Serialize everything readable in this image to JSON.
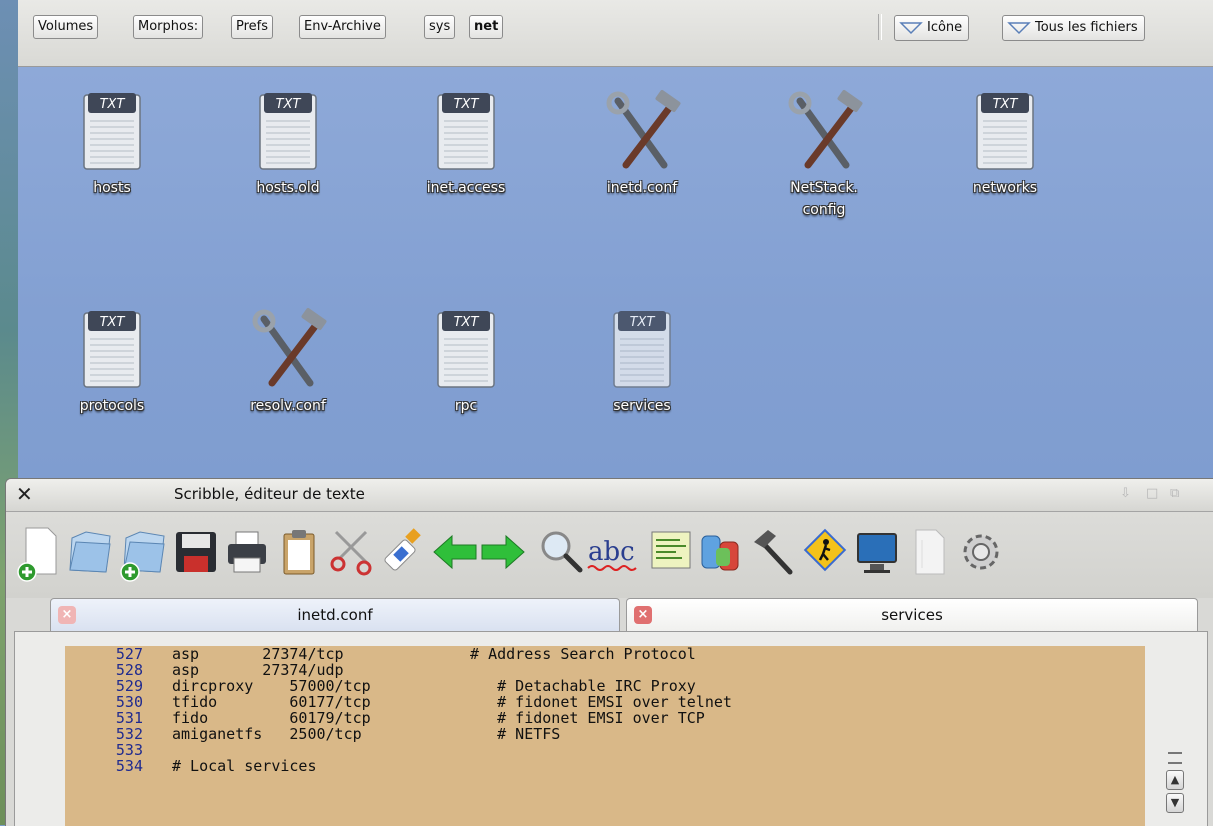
{
  "file_manager": {
    "breadcrumbs": [
      "Volumes",
      "Morphos:",
      "Prefs",
      "Env-Archive",
      "sys",
      "net"
    ],
    "view_mode": "Icône",
    "filter": "Tous les fichiers",
    "files": [
      {
        "name": "hosts",
        "type": "txt"
      },
      {
        "name": "hosts.old",
        "type": "txt"
      },
      {
        "name": "inet.access",
        "type": "txt"
      },
      {
        "name": "inetd.conf",
        "type": "config"
      },
      {
        "name": "NetStack.\nconfig",
        "type": "config"
      },
      {
        "name": "networks",
        "type": "txt"
      },
      {
        "name": "protocols",
        "type": "txt"
      },
      {
        "name": "resolv.conf",
        "type": "config"
      },
      {
        "name": "rpc",
        "type": "txt"
      },
      {
        "name": "services",
        "type": "txt"
      }
    ]
  },
  "editor": {
    "title": "Scribble, éditeur de texte",
    "toolbar_icons": [
      "new-document-icon",
      "open-folder-icon",
      "new-folder-icon",
      "save-icon",
      "print-icon",
      "clipboard-icon",
      "scissors-icon",
      "glue-icon",
      "undo-arrow-icon",
      "redo-arrow-icon",
      "search-icon",
      "spellcheck-icon",
      "terminal-icon",
      "tags-icon",
      "hammer-icon",
      "hiker-sign-icon",
      "display-icon",
      "page-icon",
      "settings-gear-icon"
    ],
    "tabs": [
      {
        "label": "inetd.conf",
        "active": false
      },
      {
        "label": "services",
        "active": true
      }
    ],
    "lines": [
      {
        "num": "527",
        "text": "asp       27374/tcp              # Address Search Protocol"
      },
      {
        "num": "528",
        "text": "asp       27374/udp"
      },
      {
        "num": "529",
        "text": "dircproxy    57000/tcp              # Detachable IRC Proxy"
      },
      {
        "num": "530",
        "text": "tfido        60177/tcp              # fidonet EMSI over telnet"
      },
      {
        "num": "531",
        "text": "fido         60179/tcp              # fidonet EMSI over TCP"
      },
      {
        "num": "532",
        "text": "amiganetfs   2500/tcp               # NETFS"
      },
      {
        "num": "533",
        "text": ""
      },
      {
        "num": "534",
        "text": "# Local services"
      }
    ]
  },
  "colors": {
    "desktop_bg": "#83a0d2",
    "editor_bg": "#d9b888",
    "line_number": "#1f2a8f",
    "tab_close": "#e08080"
  }
}
